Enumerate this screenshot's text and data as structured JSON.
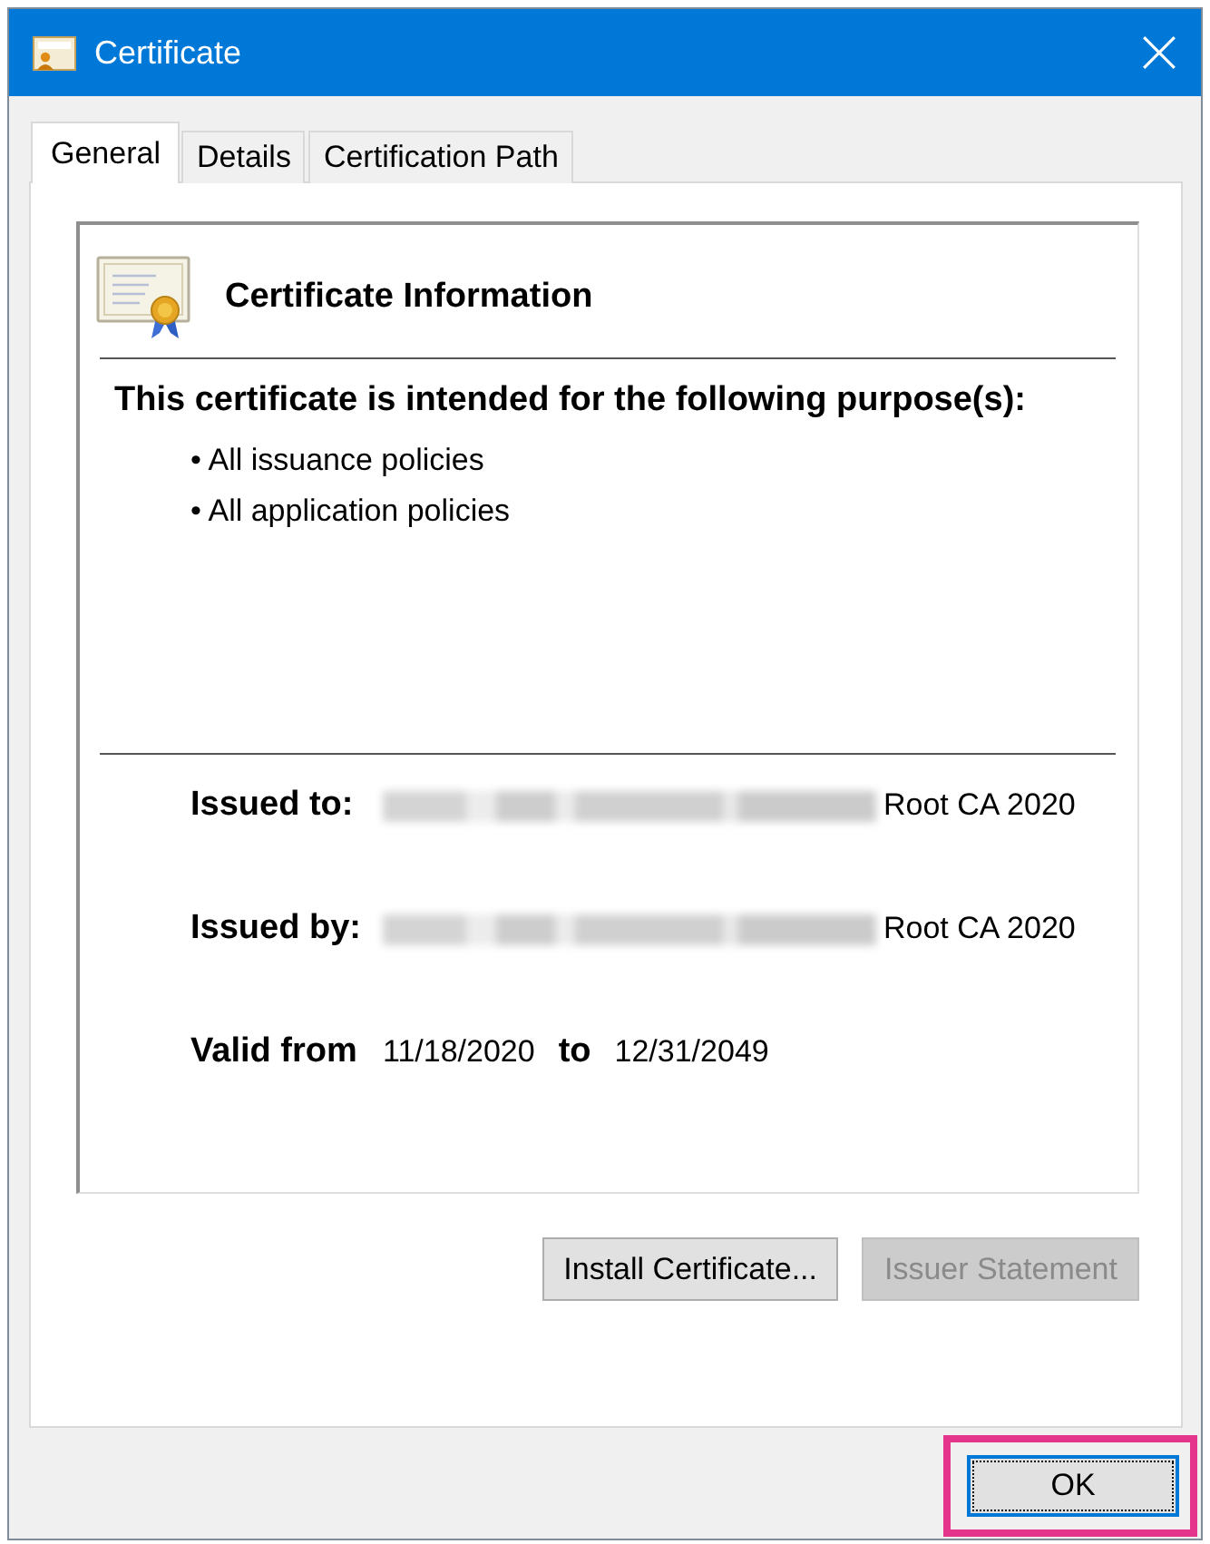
{
  "window": {
    "title": "Certificate"
  },
  "tabs": [
    {
      "label": "General",
      "selected": true
    },
    {
      "label": "Details",
      "selected": false
    },
    {
      "label": "Certification Path",
      "selected": false
    }
  ],
  "info": {
    "heading": "Certificate Information",
    "purpose_heading": "This certificate is intended for the following purpose(s):",
    "purposes": [
      "• All issuance policies",
      "• All application policies"
    ],
    "fields": [
      {
        "kind": "party",
        "label": "Issued to:",
        "redacted": true,
        "value": "Root CA 2020"
      },
      {
        "kind": "party",
        "label": "Issued by:",
        "redacted": true,
        "value": "Root CA 2020"
      },
      {
        "kind": "validity",
        "label": "Valid from",
        "from": "11/18/2020",
        "joiner": "to",
        "to": "12/31/2049"
      }
    ]
  },
  "panel_buttons": [
    {
      "label": "Install Certificate...",
      "disabled": false
    },
    {
      "label": "Issuer Statement",
      "disabled": true
    }
  ],
  "footer_buttons": [
    {
      "label": "OK",
      "focused": true,
      "highlighted": true
    }
  ]
}
